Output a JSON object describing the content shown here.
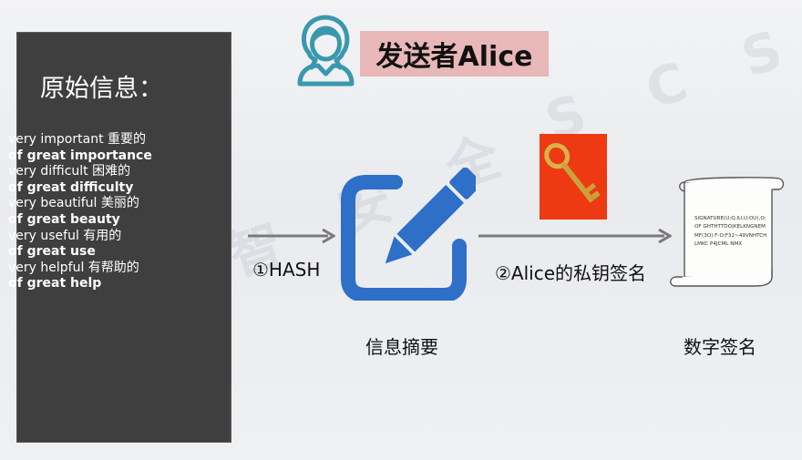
{
  "header": {
    "title": "发送者Alice"
  },
  "left_panel": {
    "title": "原始信息：",
    "lines": [
      "very important 重要的",
      "of great importance",
      "very difficult 困难的",
      "of great difficulty",
      "very beautiful 美丽的",
      "of great beauty",
      "very useful 有用的",
      "of great use",
      "very helpful 有帮助的",
      "of great help"
    ]
  },
  "steps": {
    "hash_label": "①HASH",
    "sign_label": "②Alice的私钥签名"
  },
  "captions": {
    "digest": "信息摘要",
    "signature": "数字签名"
  },
  "signature_text": "SIGNATURE(U;Q,IU,U;OU),O;OF GHTHTTDO|KELKNGNEMMF(3O) F-O;F32~49VNHTCHLMKC P4JCML NMX",
  "watermark_chars": [
    "智",
    "安",
    "全",
    "S",
    "C",
    "S"
  ],
  "colors": {
    "panel_bg": "#3f3f3f",
    "header_bg": "#e8b7b7",
    "icon_blue": "#2e6fc8",
    "avatar_teal": "#3a98ae",
    "key_bg": "#ee3a12"
  }
}
